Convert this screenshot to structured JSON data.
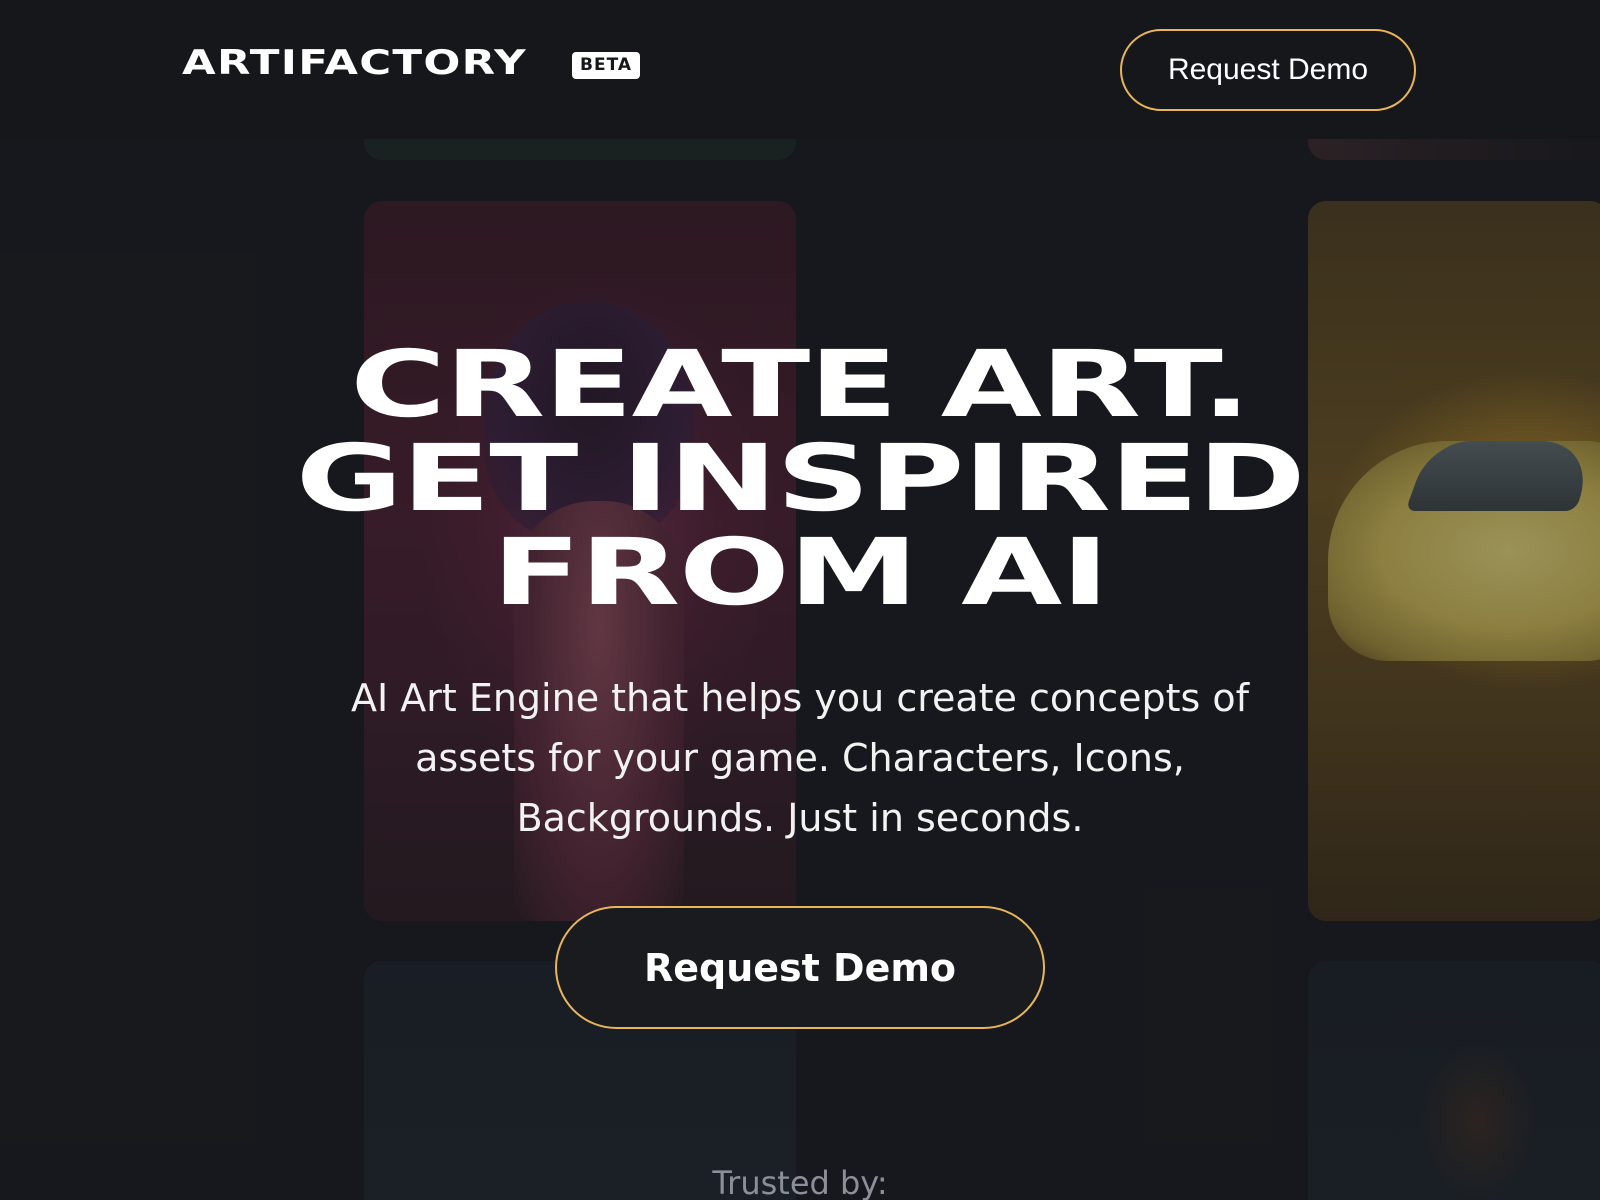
{
  "header": {
    "logo_text": "ARTIFACTORY",
    "badge_text": "BETA",
    "cta_label": "Request Demo"
  },
  "hero": {
    "title_lines": [
      "CREATE ART.",
      "GET INSPIRED",
      "FROM AI"
    ],
    "subtitle": "AI Art Engine that helps you create concepts of assets for your game. Characters, Icons, Backgrounds. Just in seconds.",
    "cta_label": "Request Demo"
  },
  "trusted_label": "Trusted by:",
  "colors": {
    "background": "#1a1b1f",
    "header_background": "#16171b",
    "accent_border": "#e8b659",
    "text": "#ffffff",
    "muted_text": "#8b8f99"
  }
}
